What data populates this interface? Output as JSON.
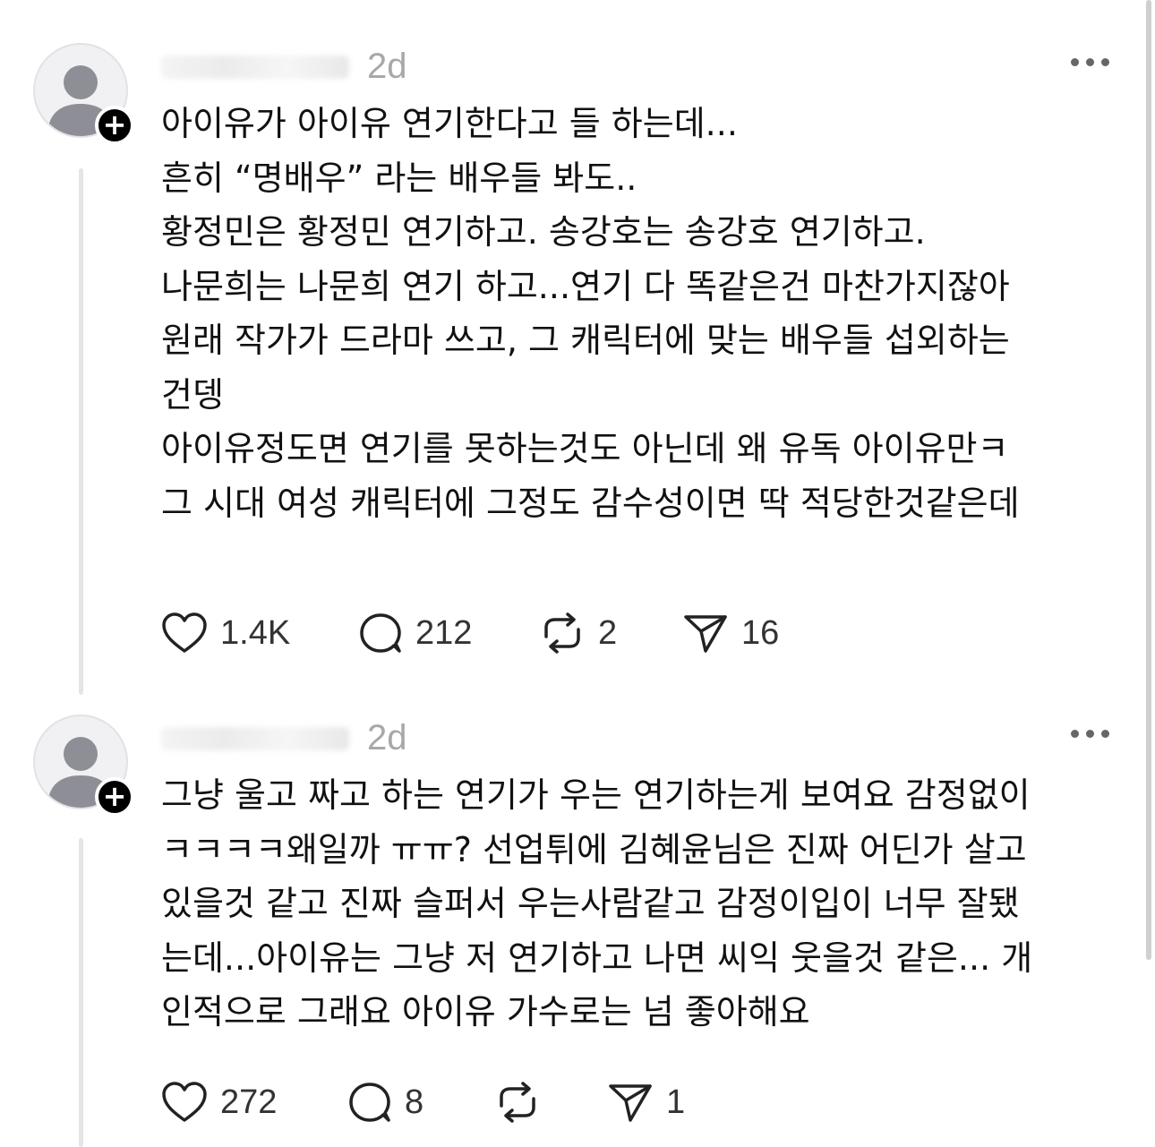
{
  "posts": [
    {
      "time": "2d",
      "lines": [
        "아이유가 아이유 연기한다고 들 하는데...",
        "흔히 “명배우” 라는 배우들 봐도..",
        "황정민은 황정민 연기하고. 송강호는 송강호 연기하고.",
        "나문희는 나문희 연기 하고...연기 다 똑같은건 마찬가지잖아",
        "원래 작가가 드라마 쓰고, 그 캐릭터에 맞는 배우들 섭외하는",
        "건뎅",
        "아이유정도면 연기를 못하는것도 아닌데 왜 유독 아이유만ㅋ",
        "그 시대 여성 캐릭터에 그정도 감수성이면 딱 적당한것같은데"
      ],
      "likes": "1.4K",
      "replies": "212",
      "reposts": "2",
      "shares": "16"
    },
    {
      "time": "2d",
      "lines": [
        "그냥 울고 짜고 하는 연기가 우는 연기하는게 보여요 감정없이",
        "ㅋㅋㅋㅋ왜일까 ㅠㅠ? 선업튀에 김혜윤님은 진짜 어딘가 살고",
        "있을것 같고 진짜 슬퍼서 우는사람같고 감정이입이 너무 잘됐",
        "는데...아이유는 그냥 저 연기하고 나면 씨익 웃을것 같은... 개",
        "인적으로 그래요 아이유 가수로는 넘 좋아해요"
      ],
      "likes": "272",
      "replies": "8",
      "reposts": "",
      "shares": "1"
    }
  ],
  "icons": {
    "like": "heart-icon",
    "reply": "speech-bubble-icon",
    "repost": "repost-arrows-icon",
    "share": "paper-plane-icon",
    "more": "more-dots-icon",
    "follow": "plus-icon",
    "avatar": "default-user-icon"
  },
  "colors": {
    "text": "#111111",
    "muted": "#999999",
    "avatar_bg": "#f1f1f3",
    "avatar_person": "#8e8e96",
    "thread_line": "#e5e5e5",
    "badge": "#000000"
  }
}
